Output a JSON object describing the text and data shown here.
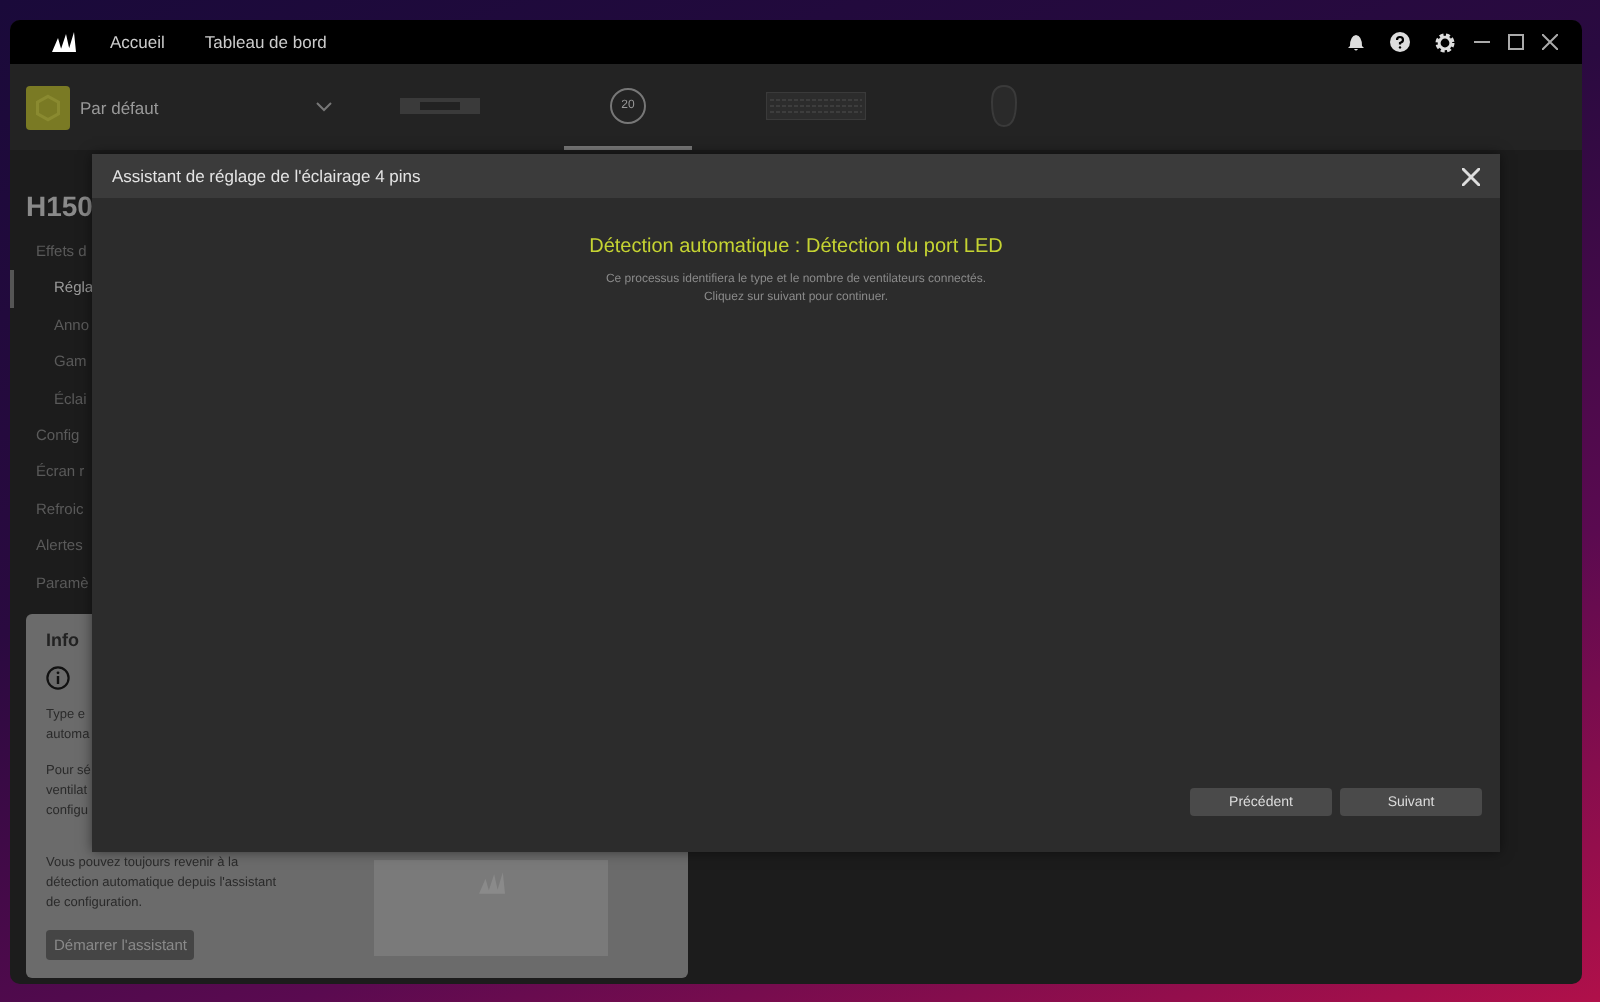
{
  "nav": [
    "Accueil",
    "Tableau de bord"
  ],
  "profile": {
    "name": "Par défaut"
  },
  "devices": [
    {
      "kind": "ram",
      "selected": false
    },
    {
      "kind": "pump",
      "label": "20",
      "selected": true
    },
    {
      "kind": "keyboard",
      "selected": false
    },
    {
      "kind": "mouse",
      "selected": false
    }
  ],
  "sidebar": {
    "title": "H150",
    "items": [
      {
        "label": "Effets d",
        "selected": false,
        "children": [
          {
            "label": "Régla",
            "selected": true
          },
          {
            "label": "Anno",
            "selected": false
          },
          {
            "label": "Gam",
            "selected": false
          },
          {
            "label": "Éclai",
            "selected": false
          }
        ]
      },
      {
        "label": "Config",
        "selected": false
      },
      {
        "label": "Écran r",
        "selected": false
      },
      {
        "label": "Refroic",
        "selected": false
      },
      {
        "label": "Alertes",
        "selected": false
      },
      {
        "label": "Paramè",
        "selected": false
      }
    ]
  },
  "info_card": {
    "title": "Info",
    "paragraphs": [
      [
        "Type e",
        "automa"
      ],
      [
        "Pour sé",
        "ventilat",
        "configu"
      ],
      [
        "Vous pouvez toujours revenir à la",
        "détection automatique depuis l'assistant",
        "de configuration."
      ]
    ],
    "button": "Démarrer l'assistant"
  },
  "dialog": {
    "title": "Assistant de réglage de l'éclairage 4 pins",
    "heading": "Détection automatique : Détection du port LED",
    "description": [
      "Ce processus identifiera le type et le nombre de ventilateurs connectés.",
      "Cliquez sur suivant pour continuer."
    ],
    "buttons": [
      "Précédent",
      "Suivant"
    ]
  }
}
